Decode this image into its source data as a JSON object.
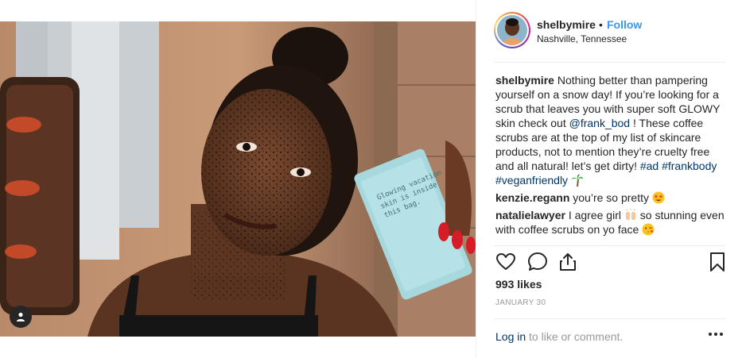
{
  "post": {
    "author": {
      "username": "shelbymire",
      "separator": "•",
      "follow_label": "Follow",
      "location": "Nashville, Tennessee"
    },
    "caption": {
      "username": "shelbymire",
      "text_before_mention": "Nothing better than pampering yourself on a snow day! If you’re looking for a scrub that leaves you with super soft GLOWY skin check out",
      "mention": "@frank_bod",
      "text_after_mention": "! These coffee scrubs are at the top of my list of skincare products, not to mention they’re cruelty free and all natural! let’s get dirty!",
      "hashtags": [
        "#ad",
        "#frankbody",
        "#veganfriendly"
      ],
      "trailing_emoji": "palm-tree-emoji"
    },
    "comments": [
      {
        "username": "kenzie.regann",
        "text": "you’re so pretty",
        "emoji": "star-struck-emoji"
      },
      {
        "username": "natalielawyer",
        "text_before_emoji": "I agree girl",
        "emoji": "raised-hands-emoji",
        "text_after_emoji": "so stunning even with coffee scrubs on yo face",
        "trailing_emoji": "kissing-heart-emoji"
      }
    ],
    "likes_text": "993 likes",
    "date_text": "JANUARY 30",
    "footer": {
      "login_label": "Log in",
      "suffix_text": "to like or comment."
    },
    "icons": {
      "like": "heart-icon",
      "comment": "comment-icon",
      "share": "share-icon",
      "save": "bookmark-icon",
      "more": "more-options-icon",
      "user_tag": "user-tag-icon"
    },
    "colors": {
      "follow": "#3897f0",
      "link": "#003569",
      "muted": "#999999",
      "text": "#262626"
    }
  }
}
